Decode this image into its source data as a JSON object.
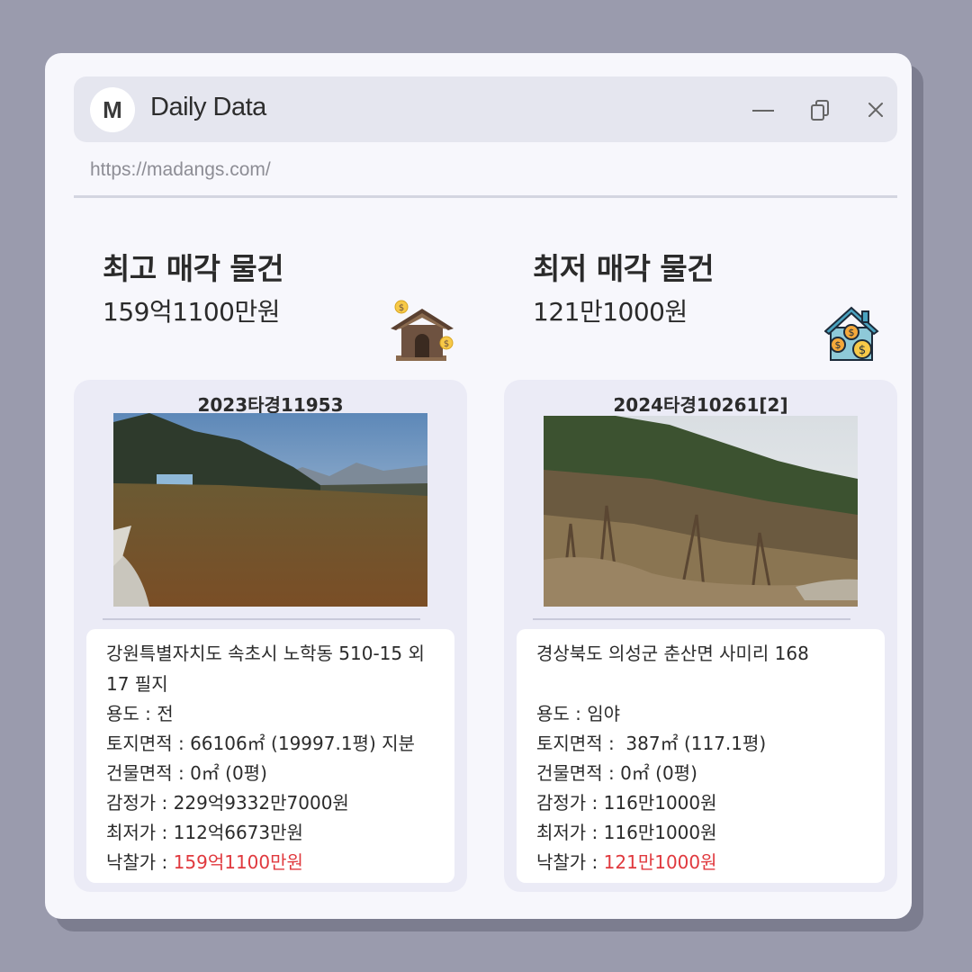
{
  "window": {
    "logo_letter": "M",
    "title": "Daily Data",
    "url": "https://madangs.com/"
  },
  "highest": {
    "heading": "최고 매각 물건",
    "price": "159억1100만원",
    "icon": "house-with-coins-icon",
    "case_no": "2023타경11953",
    "photo": "farm-field-photo",
    "address": "강원특별자치도 속초시 노학동 510-15 외 17 필지",
    "usage_label": "용도 : ",
    "usage": "전",
    "land_area_label": "토지면적 : ",
    "land_area": "66106㎡ (19997.1평) 지분",
    "building_area_label": "건물면적 : ",
    "building_area": "0㎡ (0평)",
    "appraisal_label": "감정가 : ",
    "appraisal": "229억9332만7000원",
    "minimum_label": "최저가 : ",
    "minimum": "112억6673만원",
    "winning_label": "낙찰가 : ",
    "winning": "159억1100만원"
  },
  "lowest": {
    "heading": "최저 매각 물건",
    "price": "121만1000원",
    "icon": "blue-house-with-coins-icon",
    "case_no": "2024타경10261[2]",
    "photo": "forest-hillside-photo",
    "address": "경상북도 의성군 춘산면 사미리 168",
    "usage_label": "용도 : ",
    "usage": "임야",
    "land_area_label": "토지면적 : ",
    "land_area": " 387㎡ (117.1평)",
    "building_area_label": "건물면적 : ",
    "building_area": "0㎡ (0평)",
    "appraisal_label": "감정가 : ",
    "appraisal": "116만1000원",
    "minimum_label": "최저가 : ",
    "minimum": "116만1000원",
    "winning_label": "낙찰가 : ",
    "winning": "121만1000원"
  },
  "colors": {
    "accent_red": "#e0393e",
    "background": "#9a9bad",
    "window": "#f7f7fc",
    "card": "#ebebf6"
  }
}
